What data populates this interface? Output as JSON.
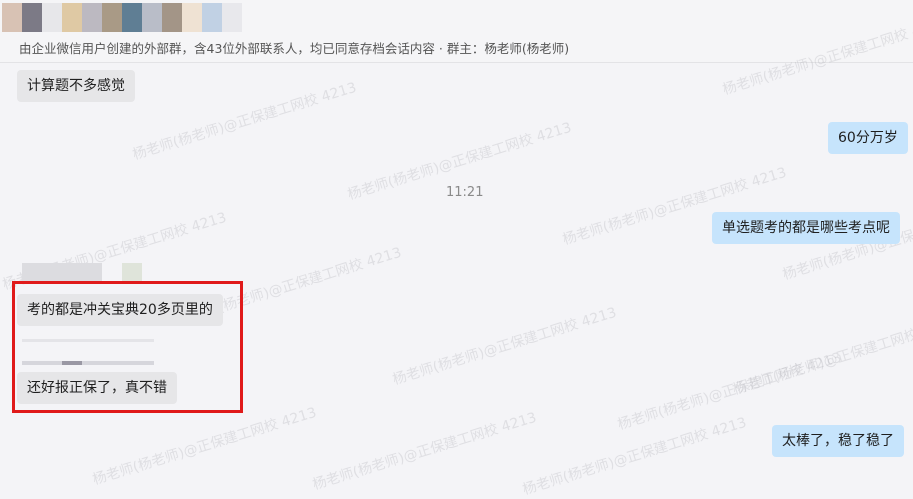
{
  "header": {
    "avatar_colors": [
      "#d8c2b4",
      "#7c7a86",
      "#e7e7ea",
      "#dfc9a4",
      "#bcb9c1",
      "#a99a86",
      "#5f7e94",
      "#b9bdc8",
      "#a39587",
      "#efe2d3",
      "#c1d1e4",
      "#e8e8ec"
    ],
    "notice": "由企业微信用户创建的外部群，含43位外部联系人，均已同意存档会话内容 · 群主：杨老师(杨老师)"
  },
  "messages": {
    "m1": "计算题不多感觉",
    "m2": "60分万岁",
    "time": "11:21",
    "m3": "单选题考的都是哪些考点呢",
    "m4": "考的都是冲关宝典20多页里的",
    "m5": "还好报正保了，真不错",
    "m6": "太棒了，稳了稳了"
  },
  "watermark": "杨老师(杨老师)@正保建工网校 4213",
  "colors": {
    "incoming_bubble": "#e6e6e8",
    "outgoing_bubble": "#c6e4fc",
    "highlight_box": "#e01a1a"
  }
}
